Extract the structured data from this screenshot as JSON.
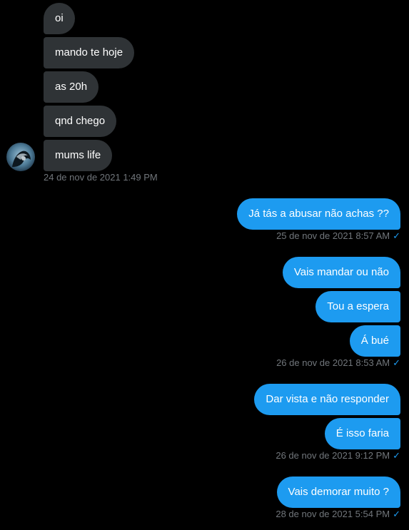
{
  "thread": {
    "incoming": [
      {
        "text": "oi"
      },
      {
        "text": "mando te hoje"
      },
      {
        "text": "as 20h"
      },
      {
        "text": "qnd chego"
      },
      {
        "text": "mums life"
      }
    ],
    "incoming_timestamp": "24 de nov de 2021 1:49 PM",
    "outgoing_groups": [
      {
        "messages": [
          "Já tás a abusar não achas ??"
        ],
        "timestamp": "25 de nov de 2021 8:57 AM"
      },
      {
        "messages": [
          "Vais mandar ou não",
          "Tou a espera",
          "Á bué"
        ],
        "timestamp": "26 de nov de 2021 8:53 AM"
      },
      {
        "messages": [
          "Dar vista e não responder",
          "É isso faria"
        ],
        "timestamp": "26 de nov de 2021 9:12 PM"
      },
      {
        "messages": [
          "Vais demorar muito ?"
        ],
        "timestamp": "28 de nov de 2021 5:54 PM"
      }
    ],
    "read_icon": "checkmark-icon",
    "colors": {
      "background": "#000000",
      "incoming_bubble": "#2f3336",
      "outgoing_bubble": "#1d9bf0",
      "timestamp": "#71767b"
    }
  }
}
